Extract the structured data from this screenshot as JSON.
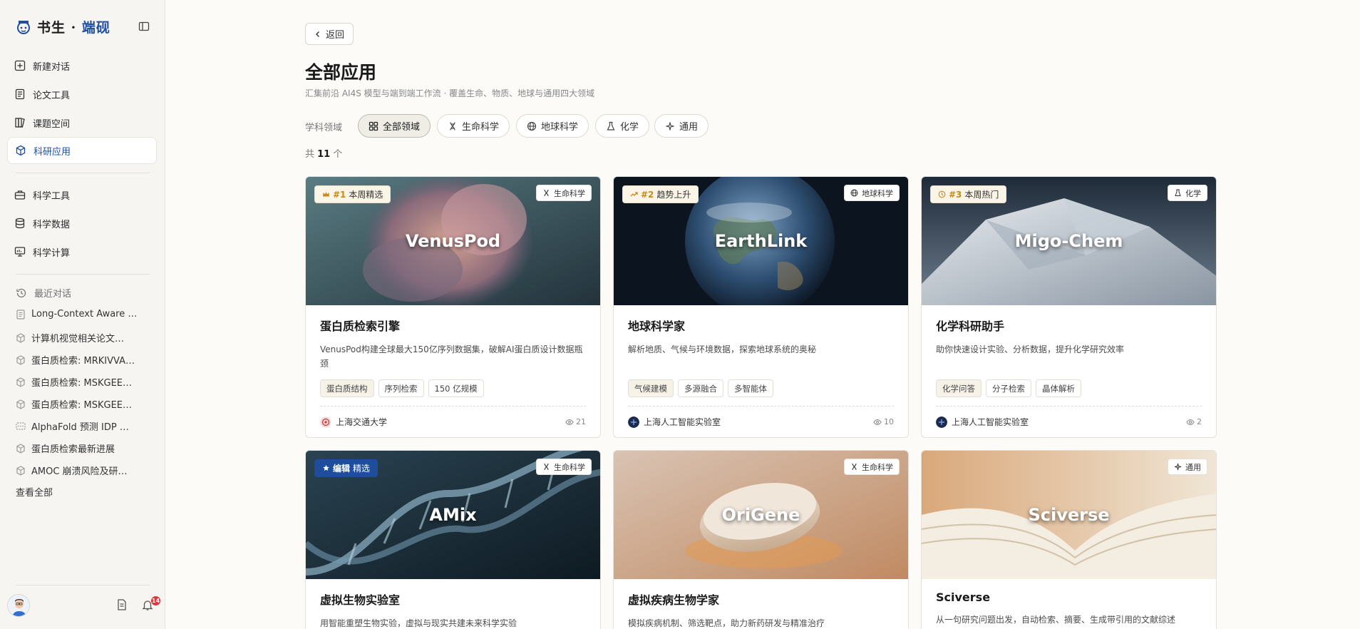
{
  "app": {
    "brand_main": "书生 · ",
    "brand_accent": "端砚"
  },
  "sidebar": {
    "nav": [
      {
        "label": "新建对话",
        "icon": "plus-square-icon"
      },
      {
        "label": "论文工具",
        "icon": "document-icon"
      },
      {
        "label": "课题空间",
        "icon": "book-icon"
      },
      {
        "label": "科研应用",
        "icon": "cube-icon"
      }
    ],
    "nav2": [
      {
        "label": "科学工具",
        "icon": "toolbox-icon"
      },
      {
        "label": "科学数据",
        "icon": "database-icon"
      },
      {
        "label": "科学计算",
        "icon": "monitor-icon"
      }
    ],
    "recent_title": "最近对话",
    "recent": [
      {
        "label": "Long-Context Aware …",
        "icon": "document-icon"
      },
      {
        "label": "计算机视觉相关论文…",
        "icon": "cube-icon"
      },
      {
        "label": "蛋白质检索: MRKIVVA…",
        "icon": "cube-icon"
      },
      {
        "label": "蛋白质检索: MSKGEE…",
        "icon": "cube-icon"
      },
      {
        "label": "蛋白质检索: MSKGEE…",
        "icon": "cube-icon"
      },
      {
        "label": "AlphaFold 预测 IDP …",
        "icon": "chat-icon"
      },
      {
        "label": "蛋白质检索最新进展",
        "icon": "cube-icon"
      },
      {
        "label": "AMOC 崩溃风险及研…",
        "icon": "cube-icon"
      }
    ],
    "view_all": "查看全部",
    "notification_count": "14"
  },
  "main": {
    "back_label": "返回",
    "title": "全部应用",
    "subtitle": "汇集前沿 AI4S 模型与端到端工作流 · 覆盖生命、物质、地球与通用四大领域",
    "filter_label": "学科领域",
    "filters": [
      {
        "label": "全部领域",
        "icon": "grid-icon",
        "active": true
      },
      {
        "label": "生命科学",
        "icon": "dna-icon",
        "active": false
      },
      {
        "label": "地球科学",
        "icon": "globe-icon",
        "active": false
      },
      {
        "label": "化学",
        "icon": "flask-icon",
        "active": false
      },
      {
        "label": "通用",
        "icon": "sparkle-icon",
        "active": false
      }
    ],
    "count_prefix": "共 ",
    "count_value": "11",
    "count_suffix": " 个"
  },
  "cards": [
    {
      "hero_name": "VenusPod",
      "rank": "#1",
      "rank_label": "本周精选",
      "rank_icon": "crown-icon",
      "domain": "生命科学",
      "title": "蛋白质检索引擎",
      "desc": "VenusPod构建全球最大150亿序列数据集，破解AI蛋白质设计数据瓶颈",
      "tags": [
        "蛋白质结构",
        "序列检索",
        "150 亿规模"
      ],
      "org": "上海交通大学",
      "views": "21"
    },
    {
      "hero_name": "EarthLink",
      "rank": "#2",
      "rank_label": "趋势上升",
      "rank_icon": "trend-up-icon",
      "domain": "地球科学",
      "title": "地球科学家",
      "desc": "解析地质、气候与环境数据，探索地球系统的奥秘",
      "tags": [
        "气候建模",
        "多源融合",
        "多智能体"
      ],
      "org": "上海人工智能实验室",
      "views": "10"
    },
    {
      "hero_name": "Migo-Chem",
      "rank": "#3",
      "rank_label": "本周热门",
      "rank_icon": "clock-icon",
      "domain": "化学",
      "title": "化学科研助手",
      "desc": "助你快速设计实验、分析数据，提升化学研究效率",
      "tags": [
        "化学问答",
        "分子检索",
        "晶体解析"
      ],
      "org": "上海人工智能实验室",
      "views": "2"
    },
    {
      "hero_name": "AMix",
      "rank": "编辑",
      "rank_label": "精选",
      "rank_icon": "star-icon",
      "domain": "生命科学",
      "title": "虚拟生物实验室",
      "desc": "用智能重塑生物实验，虚拟与现实共建未来科学实验"
    },
    {
      "hero_name": "OriGene",
      "domain": "生命科学",
      "title": "虚拟疾病生物学家",
      "desc": "模拟疾病机制、筛选靶点，助力新药研发与精准治疗"
    },
    {
      "hero_name": "Sciverse",
      "domain": "通用",
      "title": "Sciverse",
      "desc": "从一句研究问题出发，自动检索、摘要、生成带引用的文献综述"
    }
  ],
  "colors": {
    "accent": "#1f4fa0",
    "rank_gold": "#c68a19",
    "badge_red": "#e1373b"
  }
}
